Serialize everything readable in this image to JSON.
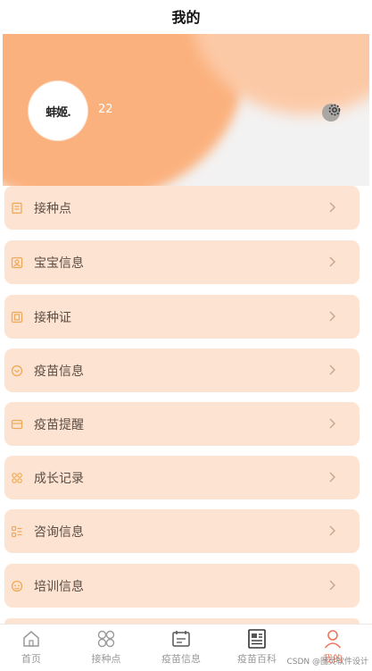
{
  "header": {
    "title": "我的"
  },
  "profile": {
    "avatar_text": "蚌姬.",
    "username": "22"
  },
  "menu": [
    {
      "label": "接种点",
      "icon": "list-icon"
    },
    {
      "label": "宝宝信息",
      "icon": "id-card-icon"
    },
    {
      "label": "接种证",
      "icon": "certificate-icon"
    },
    {
      "label": "疫苗信息",
      "icon": "info-circle-icon"
    },
    {
      "label": "疫苗提醒",
      "icon": "reminder-icon"
    },
    {
      "label": "成长记录",
      "icon": "growth-icon"
    },
    {
      "label": "咨询信息",
      "icon": "consult-icon"
    },
    {
      "label": "培训信息",
      "icon": "training-icon"
    }
  ],
  "tabbar": [
    {
      "label": "首页",
      "icon": "home-icon"
    },
    {
      "label": "接种点",
      "icon": "grid-icon"
    },
    {
      "label": "疫苗信息",
      "icon": "calendar-icon"
    },
    {
      "label": "疫苗百科",
      "icon": "news-icon"
    },
    {
      "label": "我的",
      "icon": "user-icon",
      "active": true
    }
  ],
  "watermark": "CSDN @图灵软件设计",
  "colors": {
    "accent": "#fbb17d",
    "item_bg": "#fde3d2",
    "icon": "#f0a955",
    "active": "#e8775a"
  }
}
